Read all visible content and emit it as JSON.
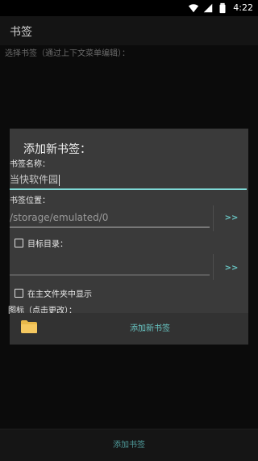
{
  "statusbar": {
    "time": "4:22",
    "icons": [
      "wifi-icon",
      "signal-icon",
      "battery-icon"
    ]
  },
  "appbar": {
    "title": "书签"
  },
  "helper_text": "选择书签（通过上下文菜单编辑）：",
  "dialog": {
    "title": "添加新书签：",
    "name_label": "书签名称：",
    "name_value": "当快软件园",
    "location_label": "书签位置：",
    "location_value": "/storage/emulated/0",
    "location_button": ">>",
    "target_checkbox_label": "目标目录：",
    "target_value": "",
    "target_button": ">>",
    "show_checkbox_label": "在主文件夹中显示",
    "icon_label": "图标（点击更改）：",
    "add_button": "添加新书签"
  },
  "bottom": {
    "add_label": "添加书签"
  },
  "colors": {
    "accent": "#69c6c4",
    "dialog_bg": "#3a3a3a",
    "background": "#0b0b0b"
  }
}
